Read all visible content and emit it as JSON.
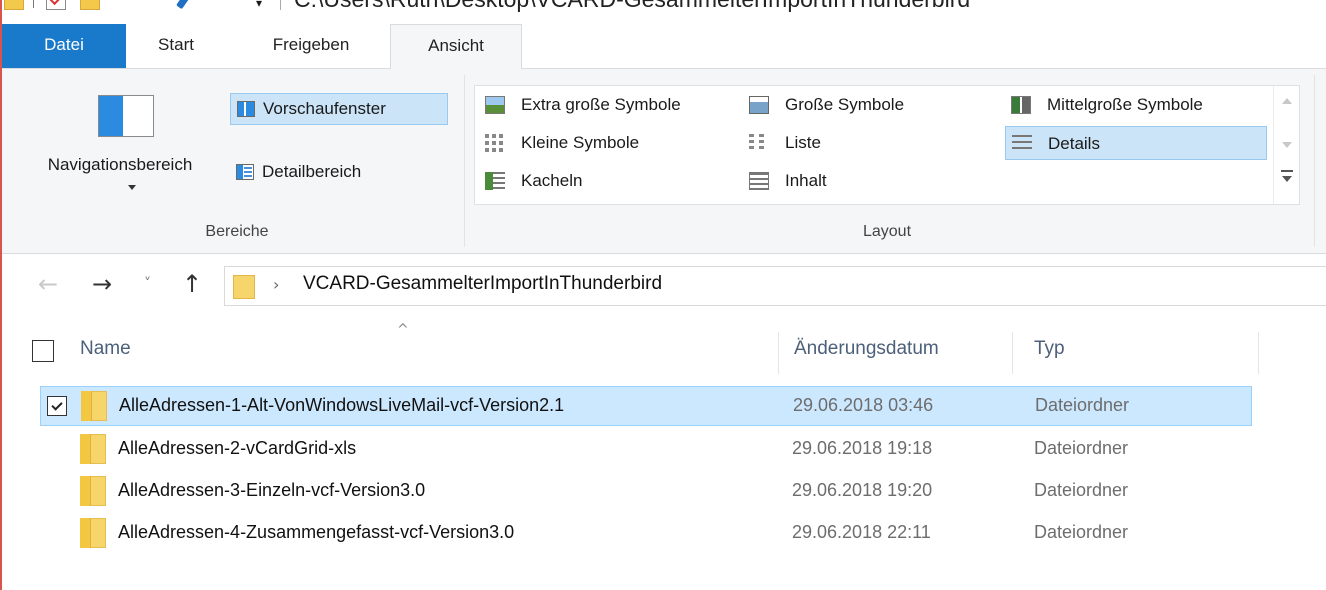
{
  "titlebar": {
    "path": "C:\\Users\\Ruth\\Desktop\\VCARD-GesammelterImportInThunderbird",
    "dropdown_glyph": "▾"
  },
  "tabs": [
    {
      "label": "Datei"
    },
    {
      "label": "Start"
    },
    {
      "label": "Freigeben"
    },
    {
      "label": "Ansicht"
    }
  ],
  "ribbon": {
    "bereiche": {
      "group_label": "Bereiche",
      "navigation_pane": "Navigationsbereich",
      "preview_pane": "Vorschaufenster",
      "details_pane": "Detailbereich"
    },
    "layout": {
      "group_label": "Layout",
      "items": [
        {
          "label": "Extra große Symbole",
          "icon": "extra-large-icons-icon"
        },
        {
          "label": "Große Symbole",
          "icon": "large-icons-icon"
        },
        {
          "label": "Mittelgroße Symbole",
          "icon": "medium-icons-icon"
        },
        {
          "label": "Kleine Symbole",
          "icon": "small-icons-icon"
        },
        {
          "label": "Liste",
          "icon": "list-icon"
        },
        {
          "label": "Details",
          "icon": "details-icon",
          "selected": true
        },
        {
          "label": "Kacheln",
          "icon": "tiles-icon"
        },
        {
          "label": "Inhalt",
          "icon": "content-icon"
        }
      ]
    }
  },
  "addressbar": {
    "breadcrumb_separator": "›",
    "current_folder": "VCARD-GesammelterImportInThunderbird",
    "back_glyph": "←",
    "forward_glyph": "→",
    "recent_glyph": "˅",
    "up_glyph": "↑"
  },
  "filelist": {
    "sort_indicator": "^",
    "columns": {
      "name": "Name",
      "date": "Änderungsdatum",
      "type": "Typ"
    },
    "rows": [
      {
        "name": "AlleAdressen-1-Alt-VonWindowsLiveMail-vcf-Version2.1",
        "date": "29.06.2018 03:46",
        "type": "Dateiordner",
        "selected": true
      },
      {
        "name": "AlleAdressen-2-vCardGrid-xls",
        "date": "29.06.2018 19:18",
        "type": "Dateiordner"
      },
      {
        "name": "AlleAdressen-3-Einzeln-vcf-Version3.0",
        "date": "29.06.2018 19:20",
        "type": "Dateiordner"
      },
      {
        "name": "AlleAdressen-4-Zusammengefasst-vcf-Version3.0",
        "date": "29.06.2018 22:11",
        "type": "Dateiordner"
      }
    ]
  },
  "colors": {
    "accent": "#1979ca",
    "selection": "#cce8ff",
    "folder": "#f6d56a"
  }
}
